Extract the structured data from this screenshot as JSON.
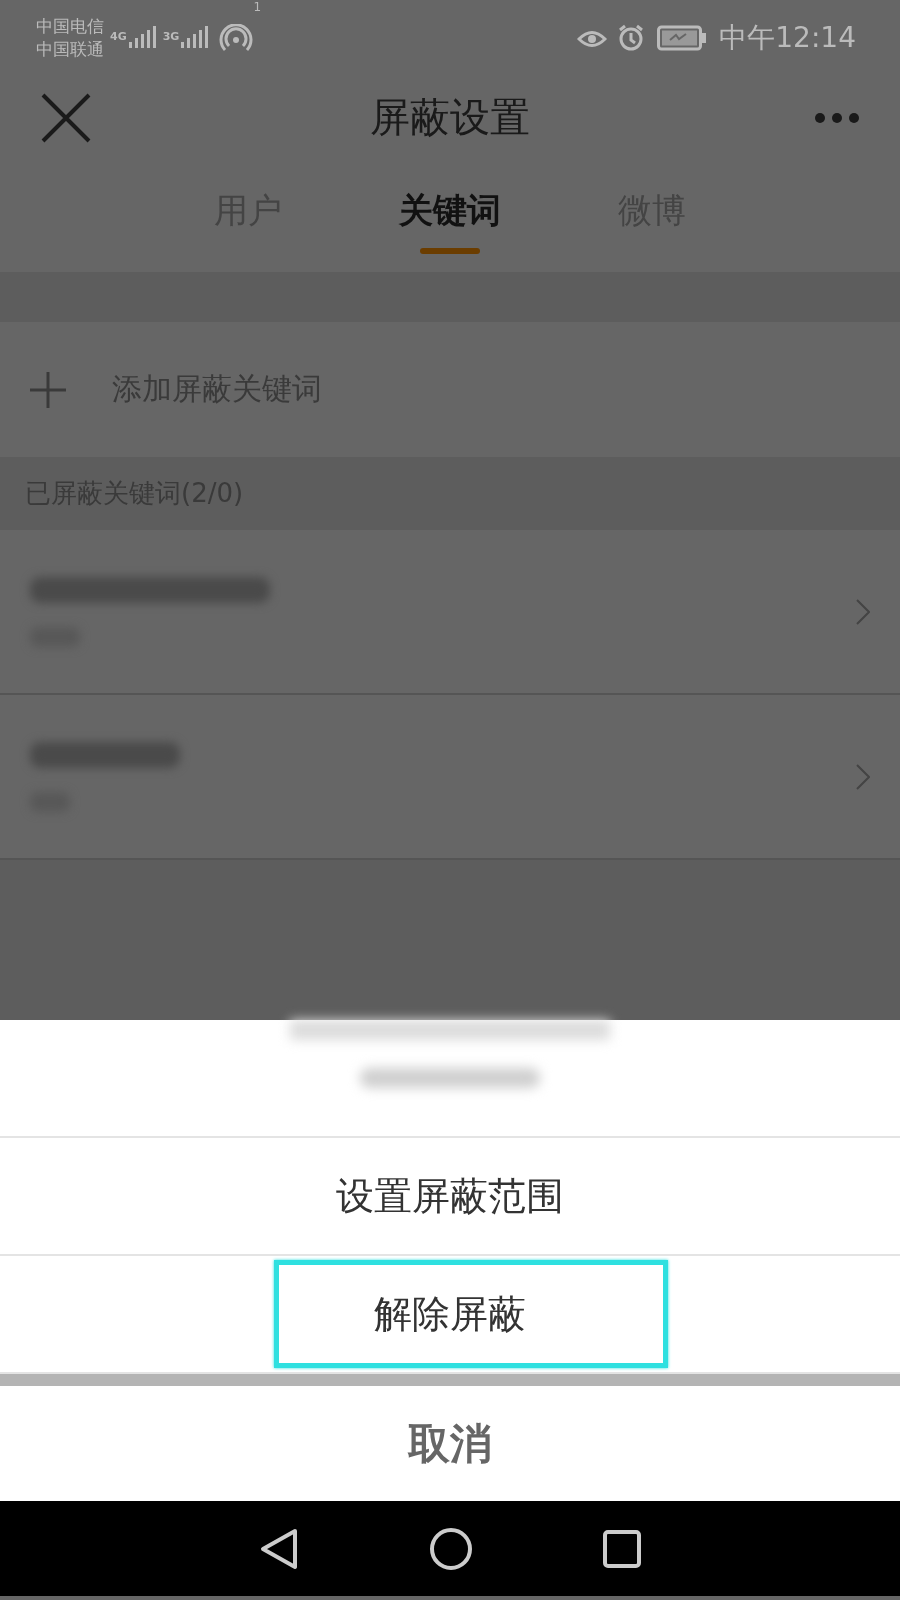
{
  "status_bar": {
    "carriers": [
      "中国电信",
      "中国联通"
    ],
    "networks": [
      "4G",
      "3G"
    ],
    "hotspot_count": "1",
    "time": "中午12:14"
  },
  "header": {
    "title": "屏蔽设置"
  },
  "tabs": [
    {
      "label": "用户",
      "selected": false
    },
    {
      "label": "关键词",
      "selected": true
    },
    {
      "label": "微博",
      "selected": false
    }
  ],
  "add_row": {
    "label": "添加屏蔽关键词"
  },
  "section": {
    "title": "已屏蔽关键词(2/0)"
  },
  "keywords": [
    {
      "kind": "blurred"
    },
    {
      "kind": "blurred"
    }
  ],
  "action_sheet": {
    "options": [
      {
        "label": "设置屏蔽范围",
        "highlighted": false
      },
      {
        "label": "解除屏蔽",
        "highlighted": true
      }
    ],
    "cancel": "取消"
  }
}
